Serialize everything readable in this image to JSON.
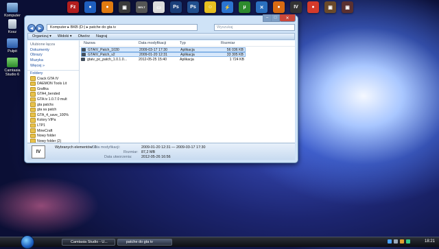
{
  "desktop": {
    "icons": [
      {
        "label": "Komputer"
      },
      {
        "label": "Kosz"
      },
      {
        "label": "Pulpit"
      },
      {
        "label": "Camtasia Studio 6"
      }
    ]
  },
  "dock": {
    "items": [
      {
        "name": "filezilla-icon",
        "color": "#b31e1e",
        "glyph": "Fz"
      },
      {
        "name": "ball-icon",
        "color": "#1f5fbf",
        "glyph": "●"
      },
      {
        "name": "firefox-globe-icon",
        "color": "#e07a10",
        "glyph": "●"
      },
      {
        "name": "game-icon",
        "color": "#3a3a3a",
        "glyph": "▣"
      },
      {
        "name": "belt-icon",
        "color": "#555555",
        "glyph": "BELT"
      },
      {
        "name": "camera-icon",
        "color": "#dddddd",
        "glyph": "▭"
      },
      {
        "name": "photoshop-icon",
        "color": "#1b3f7a",
        "glyph": "Ps"
      },
      {
        "name": "photoshop-alt-icon",
        "color": "#21508f",
        "glyph": "Ps"
      },
      {
        "name": "smiley-icon",
        "color": "#e8c020",
        "glyph": "☺"
      },
      {
        "name": "thunder-icon",
        "color": "#2c74d0",
        "glyph": "⚡"
      },
      {
        "name": "utorrent-icon",
        "color": "#2e8b2e",
        "glyph": "µ"
      },
      {
        "name": "network-icon",
        "color": "#2a6fbf",
        "glyph": "✕"
      },
      {
        "name": "firefox-icon",
        "color": "#d86a12",
        "glyph": "●"
      },
      {
        "name": "gta-iv-icon",
        "color": "#333333",
        "glyph": "IV"
      },
      {
        "name": "chrome-icon",
        "color": "#d43a2a",
        "glyph": "●"
      },
      {
        "name": "photo-icon",
        "color": "#6b4a2a",
        "glyph": "▣"
      },
      {
        "name": "dragon-icon",
        "color": "#5a3030",
        "glyph": "▣"
      }
    ]
  },
  "window": {
    "address": [
      "Komputer",
      "BKB (D:)",
      "patche do gta iv"
    ],
    "search_placeholder": "Wyszukaj",
    "toolbar": {
      "organize": "Organizuj ▾",
      "views": "Widoki ▾",
      "open": "Otwórz",
      "burn": "Nagraj"
    },
    "favorites_title": "Ulubione łącza",
    "favorites": [
      "Dokumenty",
      "Obrazy",
      "Muzyka",
      "Więcej »"
    ],
    "folders_title": "Foldery",
    "folders": [
      "Crack GTA IV",
      "DAEMON Tools Lit",
      "Grafika",
      "GTA4_bended",
      "GTA iv 1.0.7.0 mult",
      "gta patchs",
      "gta sa patch",
      "GTA_4_save_100%",
      "Kolory VIPa",
      "LTP1",
      "MineCraft",
      "Nowy folder",
      "Nowy folder (2)",
      "patche do gta iv",
      "patchs"
    ],
    "columns": {
      "name": "Nazwa",
      "date": "Data modyfikacji",
      "type": "Typ",
      "size": "Rozmiar"
    },
    "files": [
      {
        "name": "GTAIV_Patch_1030",
        "date": "2009-03-17 17:30",
        "type": "Aplikacja",
        "size": "56 036 KB",
        "selected": true
      },
      {
        "name": "GTAIV_Patch_v2",
        "date": "2009-01-20 12:31",
        "type": "Aplikacja",
        "size": "33 305 KB",
        "selected": true
      },
      {
        "name": "gtaiv_pc_patch_1.0.1.0...",
        "date": "2012-05-25 15:40",
        "type": "Aplikacja",
        "size": "1 724 KB",
        "selected": false
      }
    ],
    "details": {
      "selected": "Wybranych elementów: 2",
      "modified_label": "Data modyfikacji:",
      "modified_value": "2009-01-20 12:31 — 2009-03-17 17:30",
      "size_label": "Rozmiar:",
      "size_value": "87,2 MB",
      "created_label": "Data utworzenia:",
      "created_value": "2012-05-26 16:56"
    }
  },
  "taskbar": {
    "tasks": [
      "Camtasia Studio - U...",
      "patche do gta iv"
    ],
    "clock": "18:21"
  }
}
